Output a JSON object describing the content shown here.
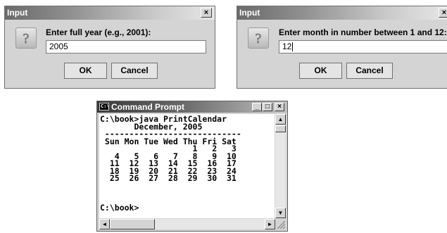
{
  "dialog_year": {
    "title": "Input",
    "close_glyph": "×",
    "icon": "question-icon",
    "prompt": "Enter full year (e.g., 2001):",
    "value": "2005",
    "ok_label": "OK",
    "cancel_label": "Cancel"
  },
  "dialog_month": {
    "title": "Input",
    "close_glyph": "×",
    "icon": "question-icon",
    "prompt": "Enter month in number between 1 and 12:",
    "value": "12",
    "ok_label": "OK",
    "cancel_label": "Cancel"
  },
  "command_prompt": {
    "title": "Command Prompt",
    "icon_label": "C:\\",
    "min_glyph": "_",
    "max_glyph": "□",
    "close_glyph": "×",
    "console_output": "C:\\book>java PrintCalendar\n       December, 2005\n ----------------------------\n Sun Mon Tue Wed Thu Fri Sat\n                   1   2   3\n   4   5   6   7   8   9  10\n  11  12  13  14  15  16  17\n  18  19  20  21  22  23  24\n  25  26  27  28  29  30  31\n\n\n\nC:\\book>",
    "scroll_up": "▲",
    "scroll_down": "▼",
    "scroll_left": "◄",
    "scroll_right": "►"
  }
}
